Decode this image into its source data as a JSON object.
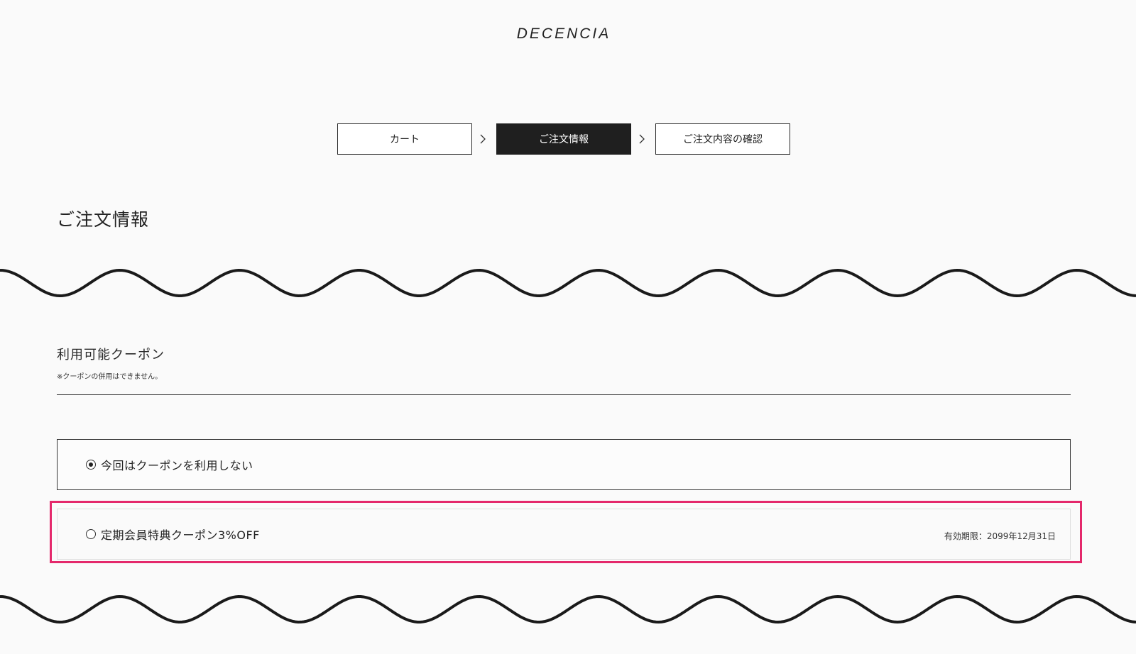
{
  "brand": {
    "logo_text": "DECENCIA"
  },
  "steps": [
    {
      "label": "カート",
      "active": false
    },
    {
      "label": "ご注文情報",
      "active": true
    },
    {
      "label": "ご注文内容の確認",
      "active": false
    }
  ],
  "page_title": "ご注文情報",
  "coupon_section": {
    "title": "利用可能クーポン",
    "note": "※クーポンの併用はできません。",
    "options": [
      {
        "label": "今回はクーポンを利用しない",
        "selected": true,
        "expiry": ""
      },
      {
        "label": "定期会員特典クーポン3%OFF",
        "selected": false,
        "expiry": "有効期限：2099年12月31日"
      }
    ]
  },
  "colors": {
    "text": "#1e1e1e",
    "active_step_bg": "#1f1f1f",
    "highlight": "#e4286b",
    "wave": "#1a1a1a"
  }
}
